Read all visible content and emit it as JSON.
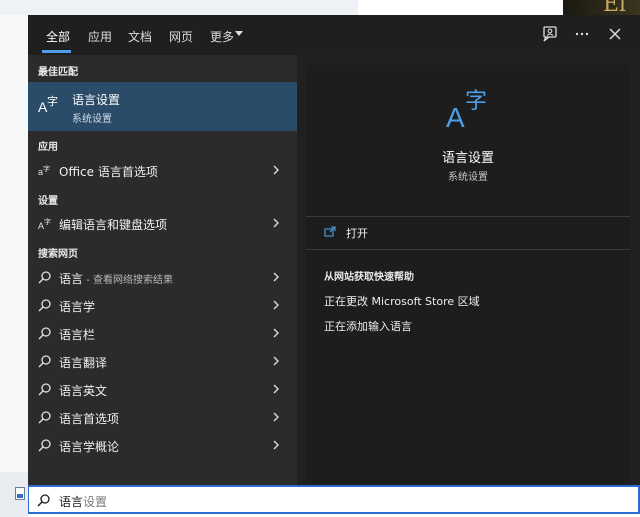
{
  "tabs": [
    {
      "label": "全部",
      "active": true
    },
    {
      "label": "应用"
    },
    {
      "label": "文档"
    },
    {
      "label": "网页"
    },
    {
      "label": "更多"
    }
  ],
  "top_icons": [
    "feedback-icon",
    "more-options-icon",
    "close-icon"
  ],
  "left": {
    "best_match_label": "最佳匹配",
    "best_match": {
      "title": "语言设置",
      "subtitle": "系统设置",
      "icon": "language-settings-icon"
    },
    "apps_label": "应用",
    "apps": [
      {
        "label": "Office 语言首选项",
        "icon": "office-language-icon"
      }
    ],
    "settings_label": "设置",
    "settings": [
      {
        "label": "编辑语言和键盘选项",
        "icon": "language-keyboard-icon"
      }
    ],
    "web_label": "搜索网页",
    "web": [
      {
        "label": "语言",
        "suffix": " - 查看网络搜索结果"
      },
      {
        "label": "语言学",
        "suffix": ""
      },
      {
        "label": "语言栏",
        "suffix": ""
      },
      {
        "label": "语言翻译",
        "suffix": ""
      },
      {
        "label": "语言英文",
        "suffix": ""
      },
      {
        "label": "语言首选项",
        "suffix": ""
      },
      {
        "label": "语言学概论",
        "suffix": ""
      }
    ]
  },
  "right": {
    "title": "语言设置",
    "subtitle": "系统设置",
    "open_label": "打开",
    "help_title": "从网站获取快速帮助",
    "links": [
      "正在更改 Microsoft Store 区域",
      "正在添加输入语言"
    ]
  },
  "search": {
    "typed": "语言",
    "completion": "设置"
  },
  "colors": {
    "accent": "#4d9ee8",
    "selected_bg": "#2a4c68",
    "search_border": "#2d6bd3"
  }
}
